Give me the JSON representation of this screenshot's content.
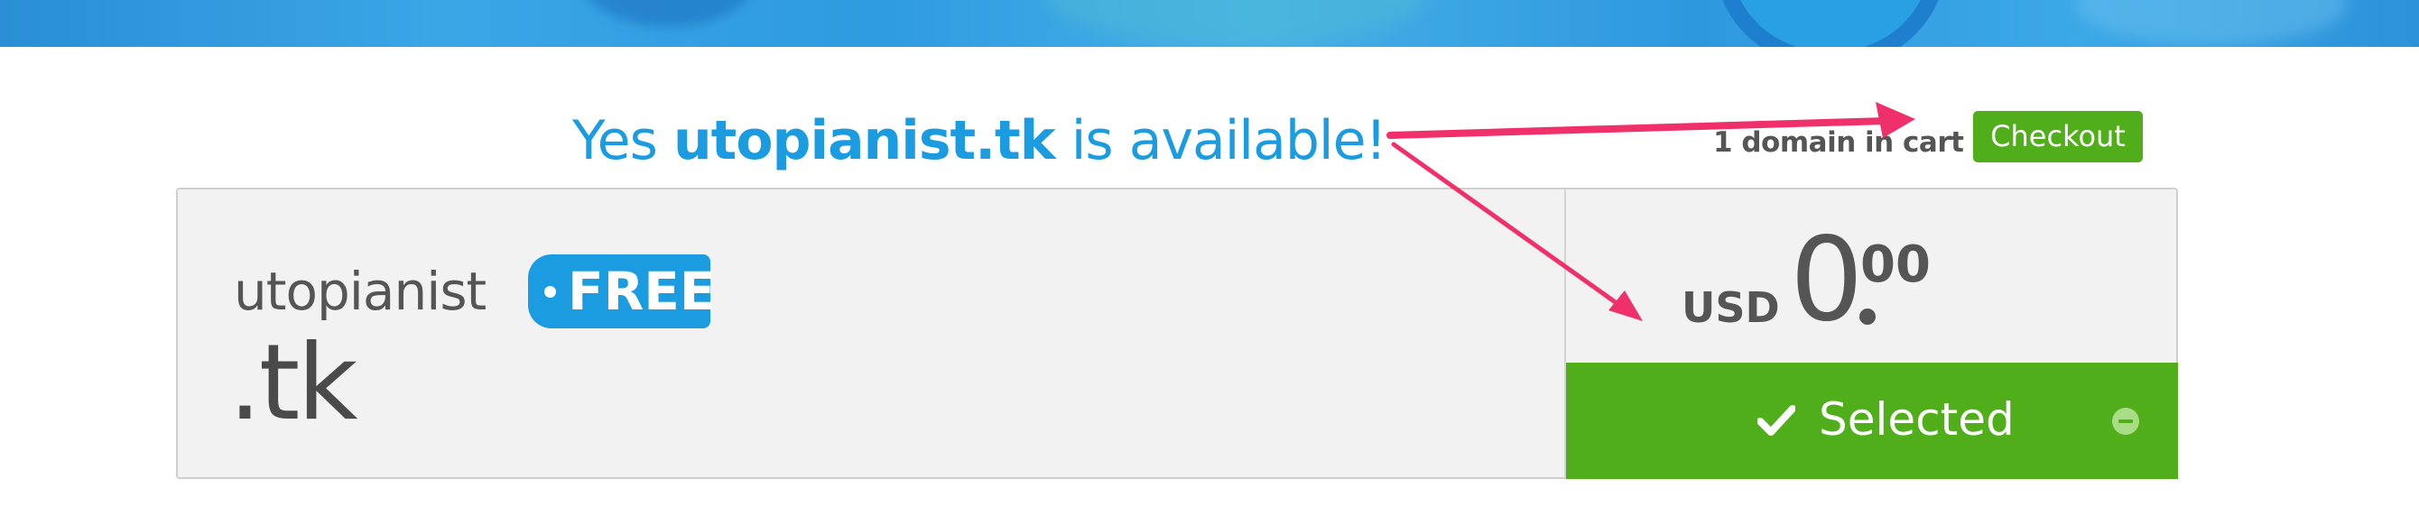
{
  "headline": {
    "prefix": "Yes ",
    "domain": "utopianist.tk",
    "suffix": " is available!"
  },
  "cart": {
    "count_text": "1 domain in cart",
    "checkout_label": "Checkout"
  },
  "result": {
    "name": "utopianist",
    "badge": "FREE",
    "tld": ".tk",
    "price": {
      "currency": "USD",
      "whole": "0",
      "fraction": "00"
    },
    "selected_label": "Selected"
  },
  "icons": {
    "check": "check-icon",
    "remove": "minus-circle-icon"
  },
  "colors": {
    "accent_blue": "#1b9be0",
    "action_green": "#4fae1a",
    "annotation_arrow": "#f0306a",
    "text_dark": "#555555"
  }
}
